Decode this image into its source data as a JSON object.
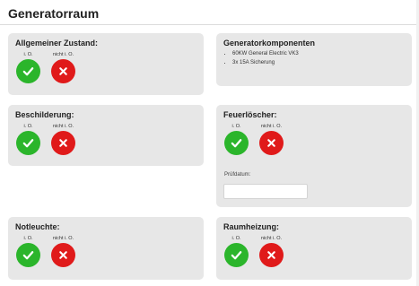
{
  "page": {
    "title": "Generatorraum"
  },
  "option_labels": {
    "ok": "i. O.",
    "not_ok": "nicht i. O."
  },
  "cards": {
    "allgemeiner_zustand": {
      "title": "Allgemeiner Zustand:"
    },
    "generatorkomponenten": {
      "title": "Generatorkomponenten",
      "items": [
        "60KW General Electric VK3",
        "3x 15A Sicherung"
      ]
    },
    "beschilderung": {
      "title": "Beschilderung:"
    },
    "feuerloescher": {
      "title": "Feuerlöscher:",
      "date_label": "Prüfdatum:",
      "date_value": ""
    },
    "notleuchte": {
      "title": "Notleuchte:"
    },
    "raumheizung": {
      "title": "Raumheizung:"
    }
  },
  "colors": {
    "ok": "#2bb52b",
    "not_ok": "#e01a1a",
    "card_bg": "#e7e7e7"
  },
  "icons": {
    "ok": "check-icon",
    "not_ok": "x-icon"
  }
}
